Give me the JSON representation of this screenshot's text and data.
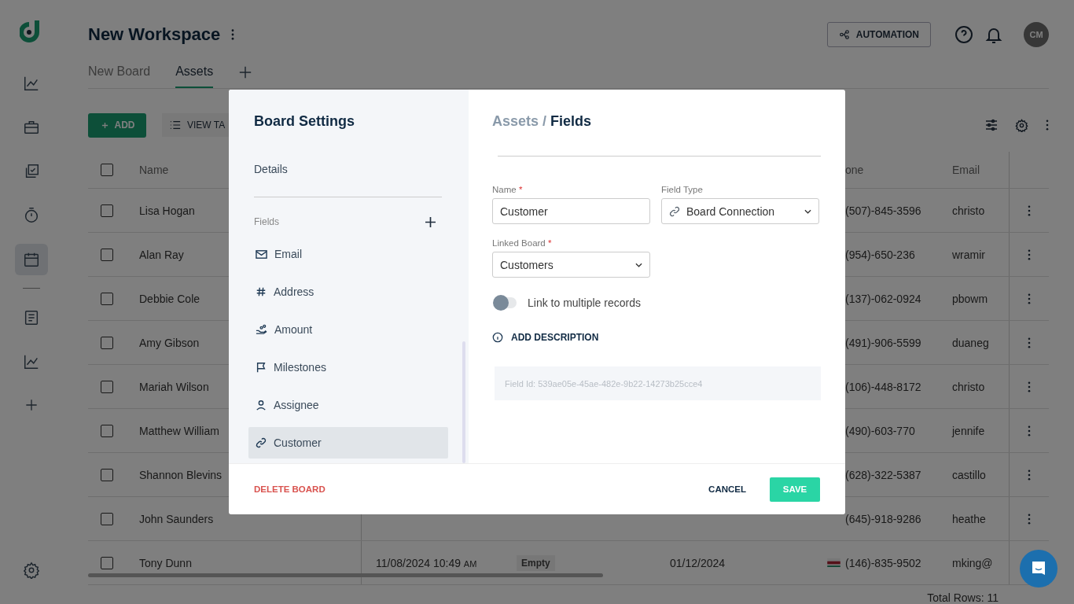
{
  "workspace": {
    "title": "New Workspace"
  },
  "header_actions": {
    "automation": "AUTOMATION",
    "avatar": "CM"
  },
  "tabs": [
    {
      "label": "New Board",
      "selected": false
    },
    {
      "label": "Assets",
      "selected": true
    }
  ],
  "toolbar": {
    "add": "ADD",
    "view": "VIEW TA"
  },
  "sidebar": {
    "items": [
      {
        "selected": false
      },
      {
        "selected": false
      },
      {
        "selected": false
      },
      {
        "selected": false
      },
      {
        "selected": true
      }
    ]
  },
  "table": {
    "select_all": false,
    "columns": [
      "Name",
      "one",
      "Email"
    ],
    "rows": [
      {
        "checked": false,
        "name": "Lisa Hogan",
        "phone": "(507)-845-3596",
        "email": "christo"
      },
      {
        "checked": false,
        "name": "Alan Ray",
        "phone": "(954)-650-236",
        "email": "wramir"
      },
      {
        "checked": false,
        "name": "Debbie Cole",
        "phone": "(137)-062-0924",
        "email": "pbowm"
      },
      {
        "checked": false,
        "name": "Amy Gibson",
        "phone": "(491)-906-5599",
        "email": "duaneg"
      },
      {
        "checked": false,
        "name": "Mariah Wilson",
        "phone": "(106)-448-8172",
        "email": "christo"
      },
      {
        "checked": false,
        "name": "Matthew William",
        "phone": "(490)-603-770",
        "email": "jennife"
      },
      {
        "checked": false,
        "name": "Shannon Blevins",
        "phone": "(628)-322-5387",
        "email": "castillo"
      },
      {
        "checked": false,
        "name": "John Saunders",
        "phone": "(645)-918-9286",
        "email": "heathe"
      },
      {
        "checked": false,
        "name": "Tony Dunn",
        "created": "11/08/2024 10:49",
        "meridiem": "AM",
        "status": "Empty",
        "date": "01/12/2024",
        "phone": "(146)-835-9502",
        "email": "mking@"
      }
    ]
  },
  "total_rows": "Total Rows: 11",
  "dialog": {
    "title": "Board Settings",
    "details": "Details",
    "fields_label": "Fields",
    "fields": [
      {
        "label": "Email",
        "kind": "email",
        "selected": false
      },
      {
        "label": "Address",
        "kind": "number",
        "selected": false
      },
      {
        "label": "Amount",
        "kind": "amount",
        "selected": false
      },
      {
        "label": "Milestones",
        "kind": "flag",
        "selected": false
      },
      {
        "label": "Assignee",
        "kind": "person",
        "selected": false
      },
      {
        "label": "Customer",
        "kind": "link",
        "selected": true
      }
    ],
    "breadcrumb": {
      "parent": "Assets",
      "separator": "/",
      "current": "Fields"
    },
    "name": {
      "label": "Name",
      "required_mark": "*",
      "value": "Customer"
    },
    "field_type": {
      "label": "Field Type",
      "value": "Board Connection"
    },
    "linked_board": {
      "label": "Linked Board",
      "required_mark": "*",
      "value": "Customers"
    },
    "multiple": {
      "label": "Link to multiple records",
      "on": false
    },
    "add_description": "ADD DESCRIPTION",
    "field_id": "Field Id: 539ae05e-45ae-482e-9b22-14273b25cce4",
    "delete": "DELETE BOARD",
    "cancel": "CANCEL",
    "save": "SAVE"
  }
}
